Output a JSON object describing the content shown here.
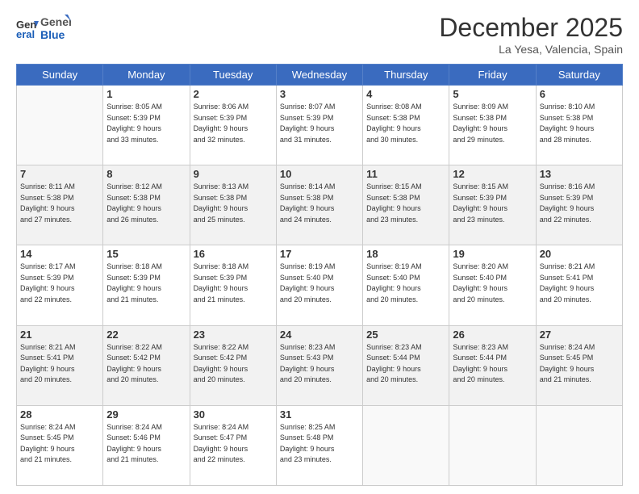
{
  "header": {
    "logo_line1": "General",
    "logo_line2": "Blue",
    "month_year": "December 2025",
    "location": "La Yesa, Valencia, Spain"
  },
  "weekdays": [
    "Sunday",
    "Monday",
    "Tuesday",
    "Wednesday",
    "Thursday",
    "Friday",
    "Saturday"
  ],
  "weeks": [
    [
      {
        "day": "",
        "info": ""
      },
      {
        "day": "1",
        "info": "Sunrise: 8:05 AM\nSunset: 5:39 PM\nDaylight: 9 hours\nand 33 minutes."
      },
      {
        "day": "2",
        "info": "Sunrise: 8:06 AM\nSunset: 5:39 PM\nDaylight: 9 hours\nand 32 minutes."
      },
      {
        "day": "3",
        "info": "Sunrise: 8:07 AM\nSunset: 5:39 PM\nDaylight: 9 hours\nand 31 minutes."
      },
      {
        "day": "4",
        "info": "Sunrise: 8:08 AM\nSunset: 5:38 PM\nDaylight: 9 hours\nand 30 minutes."
      },
      {
        "day": "5",
        "info": "Sunrise: 8:09 AM\nSunset: 5:38 PM\nDaylight: 9 hours\nand 29 minutes."
      },
      {
        "day": "6",
        "info": "Sunrise: 8:10 AM\nSunset: 5:38 PM\nDaylight: 9 hours\nand 28 minutes."
      }
    ],
    [
      {
        "day": "7",
        "info": "Sunrise: 8:11 AM\nSunset: 5:38 PM\nDaylight: 9 hours\nand 27 minutes."
      },
      {
        "day": "8",
        "info": "Sunrise: 8:12 AM\nSunset: 5:38 PM\nDaylight: 9 hours\nand 26 minutes."
      },
      {
        "day": "9",
        "info": "Sunrise: 8:13 AM\nSunset: 5:38 PM\nDaylight: 9 hours\nand 25 minutes."
      },
      {
        "day": "10",
        "info": "Sunrise: 8:14 AM\nSunset: 5:38 PM\nDaylight: 9 hours\nand 24 minutes."
      },
      {
        "day": "11",
        "info": "Sunrise: 8:15 AM\nSunset: 5:38 PM\nDaylight: 9 hours\nand 23 minutes."
      },
      {
        "day": "12",
        "info": "Sunrise: 8:15 AM\nSunset: 5:39 PM\nDaylight: 9 hours\nand 23 minutes."
      },
      {
        "day": "13",
        "info": "Sunrise: 8:16 AM\nSunset: 5:39 PM\nDaylight: 9 hours\nand 22 minutes."
      }
    ],
    [
      {
        "day": "14",
        "info": "Sunrise: 8:17 AM\nSunset: 5:39 PM\nDaylight: 9 hours\nand 22 minutes."
      },
      {
        "day": "15",
        "info": "Sunrise: 8:18 AM\nSunset: 5:39 PM\nDaylight: 9 hours\nand 21 minutes."
      },
      {
        "day": "16",
        "info": "Sunrise: 8:18 AM\nSunset: 5:39 PM\nDaylight: 9 hours\nand 21 minutes."
      },
      {
        "day": "17",
        "info": "Sunrise: 8:19 AM\nSunset: 5:40 PM\nDaylight: 9 hours\nand 20 minutes."
      },
      {
        "day": "18",
        "info": "Sunrise: 8:19 AM\nSunset: 5:40 PM\nDaylight: 9 hours\nand 20 minutes."
      },
      {
        "day": "19",
        "info": "Sunrise: 8:20 AM\nSunset: 5:40 PM\nDaylight: 9 hours\nand 20 minutes."
      },
      {
        "day": "20",
        "info": "Sunrise: 8:21 AM\nSunset: 5:41 PM\nDaylight: 9 hours\nand 20 minutes."
      }
    ],
    [
      {
        "day": "21",
        "info": "Sunrise: 8:21 AM\nSunset: 5:41 PM\nDaylight: 9 hours\nand 20 minutes."
      },
      {
        "day": "22",
        "info": "Sunrise: 8:22 AM\nSunset: 5:42 PM\nDaylight: 9 hours\nand 20 minutes."
      },
      {
        "day": "23",
        "info": "Sunrise: 8:22 AM\nSunset: 5:42 PM\nDaylight: 9 hours\nand 20 minutes."
      },
      {
        "day": "24",
        "info": "Sunrise: 8:23 AM\nSunset: 5:43 PM\nDaylight: 9 hours\nand 20 minutes."
      },
      {
        "day": "25",
        "info": "Sunrise: 8:23 AM\nSunset: 5:44 PM\nDaylight: 9 hours\nand 20 minutes."
      },
      {
        "day": "26",
        "info": "Sunrise: 8:23 AM\nSunset: 5:44 PM\nDaylight: 9 hours\nand 20 minutes."
      },
      {
        "day": "27",
        "info": "Sunrise: 8:24 AM\nSunset: 5:45 PM\nDaylight: 9 hours\nand 21 minutes."
      }
    ],
    [
      {
        "day": "28",
        "info": "Sunrise: 8:24 AM\nSunset: 5:45 PM\nDaylight: 9 hours\nand 21 minutes."
      },
      {
        "day": "29",
        "info": "Sunrise: 8:24 AM\nSunset: 5:46 PM\nDaylight: 9 hours\nand 21 minutes."
      },
      {
        "day": "30",
        "info": "Sunrise: 8:24 AM\nSunset: 5:47 PM\nDaylight: 9 hours\nand 22 minutes."
      },
      {
        "day": "31",
        "info": "Sunrise: 8:25 AM\nSunset: 5:48 PM\nDaylight: 9 hours\nand 23 minutes."
      },
      {
        "day": "",
        "info": ""
      },
      {
        "day": "",
        "info": ""
      },
      {
        "day": "",
        "info": ""
      }
    ]
  ]
}
